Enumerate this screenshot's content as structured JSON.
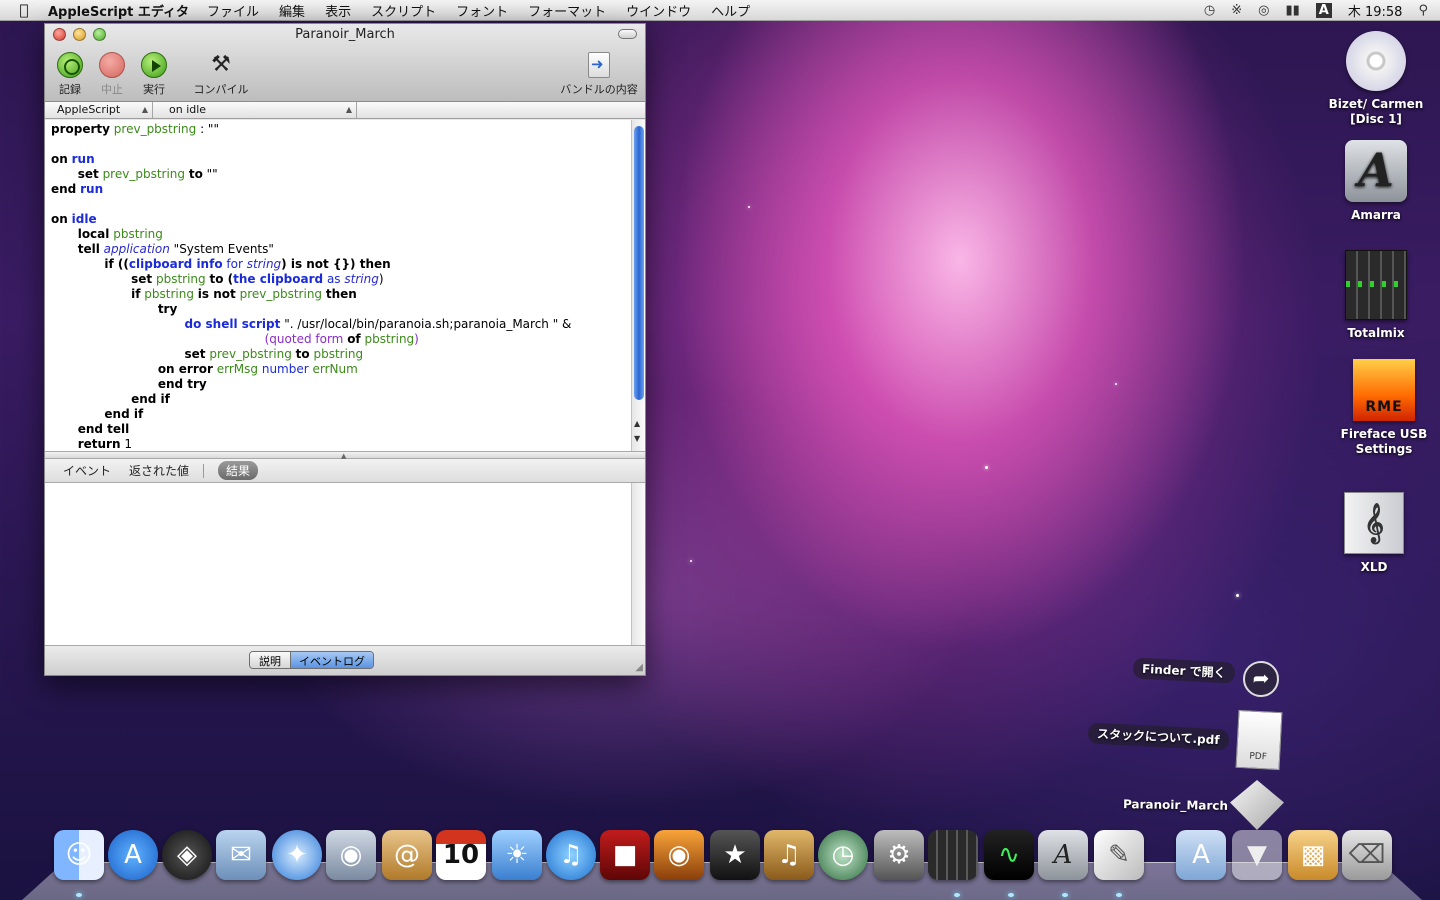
{
  "menubar": {
    "app_name": "AppleScript エディタ",
    "items": [
      "ファイル",
      "編集",
      "表示",
      "スクリプト",
      "フォント",
      "フォーマット",
      "ウインドウ",
      "ヘルプ"
    ],
    "input_indicator": "A",
    "clock": "木 19:58"
  },
  "window": {
    "title": "Paranoir_March",
    "toolbar": {
      "record": "記録",
      "stop": "中止",
      "run": "実行",
      "compile": "コンパイル",
      "bundle": "バンドルの内容"
    },
    "nav": {
      "language": "AppleScript",
      "handler": "on idle"
    },
    "result_tabs": {
      "events": "イベント",
      "returned": "返された値",
      "result": "結果"
    },
    "bottom_tabs": {
      "description": "説明",
      "event_log": "イベントログ"
    }
  },
  "code": {
    "l1": [
      "property",
      "prev_pbstring",
      ": \"\""
    ],
    "l3": [
      "on",
      "run"
    ],
    "l4": [
      "set",
      "prev_pbstring",
      "to",
      "\"\""
    ],
    "l5": [
      "end",
      "run"
    ],
    "l7": [
      "on",
      "idle"
    ],
    "l8": [
      "local",
      "pbstring"
    ],
    "l9": [
      "tell",
      "application",
      "\"System Events\""
    ],
    "l10": [
      "if ((",
      "clipboard info",
      "for",
      "string",
      ") is not {}) then"
    ],
    "l11": [
      "set",
      "pbstring",
      "to (",
      "the clipboard",
      "as",
      "string",
      ")"
    ],
    "l12": [
      "if",
      "pbstring",
      "is not",
      "prev_pbstring",
      "then"
    ],
    "l13": "try",
    "l14": [
      "do shell script",
      "\". /usr/local/bin/paranoia.sh;paranoia_March \" &"
    ],
    "l15": [
      "(",
      "quoted form",
      "of",
      "pbstring",
      ")"
    ],
    "l16": [
      "set",
      "prev_pbstring",
      "to",
      "pbstring"
    ],
    "l17": [
      "on error",
      "errMsg",
      "number",
      "errNum"
    ],
    "l18": "end try",
    "l19": "end if",
    "l20": "end if",
    "l21": "end tell",
    "l22": [
      "return",
      "1"
    ]
  },
  "desktop_icons": {
    "cd": "Bizet/ Carmen\n[Disc 1]",
    "amarra": "Amarra",
    "totalmix": "Totalmix",
    "fireface": "Fireface USB\nSettings",
    "fireface_logo": "RME",
    "xld": "XLD"
  },
  "stack": {
    "finder": "Finder で開く",
    "pdf": "スタックについて.pdf",
    "pdf_icon_label": "PDF",
    "script": "Paranoir_March"
  },
  "dock": {
    "items": [
      "Finder",
      "App Store",
      "Dashboard",
      "Mail",
      "Safari",
      "FaceTime",
      "Address Book",
      "iCal",
      "iPhoto",
      "iTunes",
      "Front Row",
      "Image Capture",
      "iMovie",
      "GarageBand",
      "Time Machine",
      "System Preferences",
      "Totalmix",
      "Activity Monitor",
      "Amarra",
      "Script Editor",
      "Applications",
      "Downloads",
      "Stack",
      "Trash"
    ],
    "ical_date": "10"
  }
}
